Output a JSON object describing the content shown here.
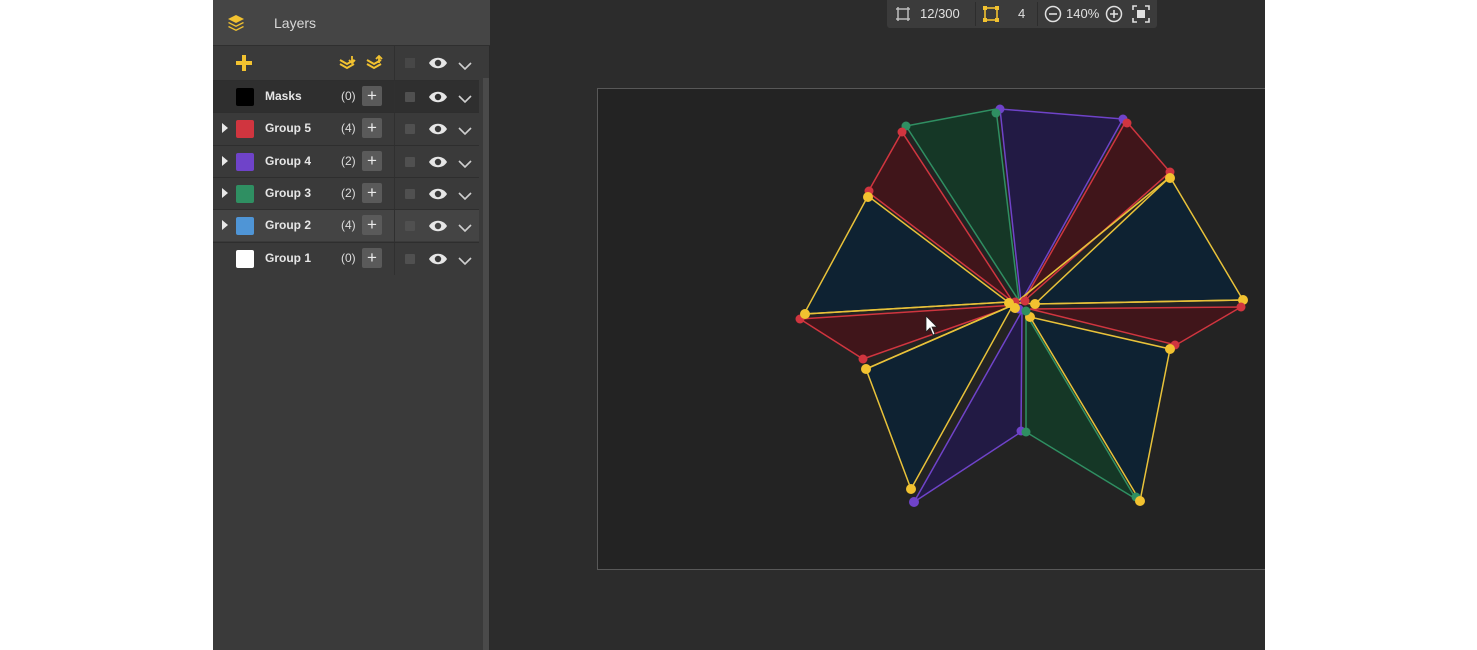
{
  "panel": {
    "title": "Layers",
    "icon": "layers-stack-icon",
    "toolbar": {
      "add_icon": "plus-icon",
      "collapse_icon": "collapse-layers-icon",
      "expand_icon": "expand-layers-icon",
      "visibility_icon": "eye-icon",
      "menu_icon": "chevron-down-icon"
    },
    "layers": [
      {
        "name": "Masks",
        "count": "(0)",
        "color": "#000000",
        "expandable": false
      },
      {
        "name": "Group 5",
        "count": "(4)",
        "color": "#d0353f",
        "expandable": true
      },
      {
        "name": "Group 4",
        "count": "(2)",
        "color": "#6f43c9",
        "expandable": true
      },
      {
        "name": "Group 3",
        "count": "(2)",
        "color": "#2f8f62",
        "expandable": true
      },
      {
        "name": "Group 2",
        "count": "(4)",
        "color": "#4f95d6",
        "expandable": true
      },
      {
        "name": "Group 1",
        "count": "(0)",
        "color": "#ffffff",
        "expandable": false
      }
    ]
  },
  "top_toolbar": {
    "frames": "12/300",
    "points": "4",
    "zoom": "140%",
    "frame_icon": "frame-icon",
    "points_icon": "bounding-box-icon",
    "zoom_out_icon": "zoom-out-icon",
    "zoom_in_icon": "zoom-in-icon",
    "fit_icon": "fit-screen-icon"
  },
  "colors": {
    "accent": "#f2c230",
    "red": "#d0353f",
    "purple": "#6f43c9",
    "green": "#2f8f62",
    "blue": "#4f95d6",
    "yellow": "#e8c23a"
  }
}
